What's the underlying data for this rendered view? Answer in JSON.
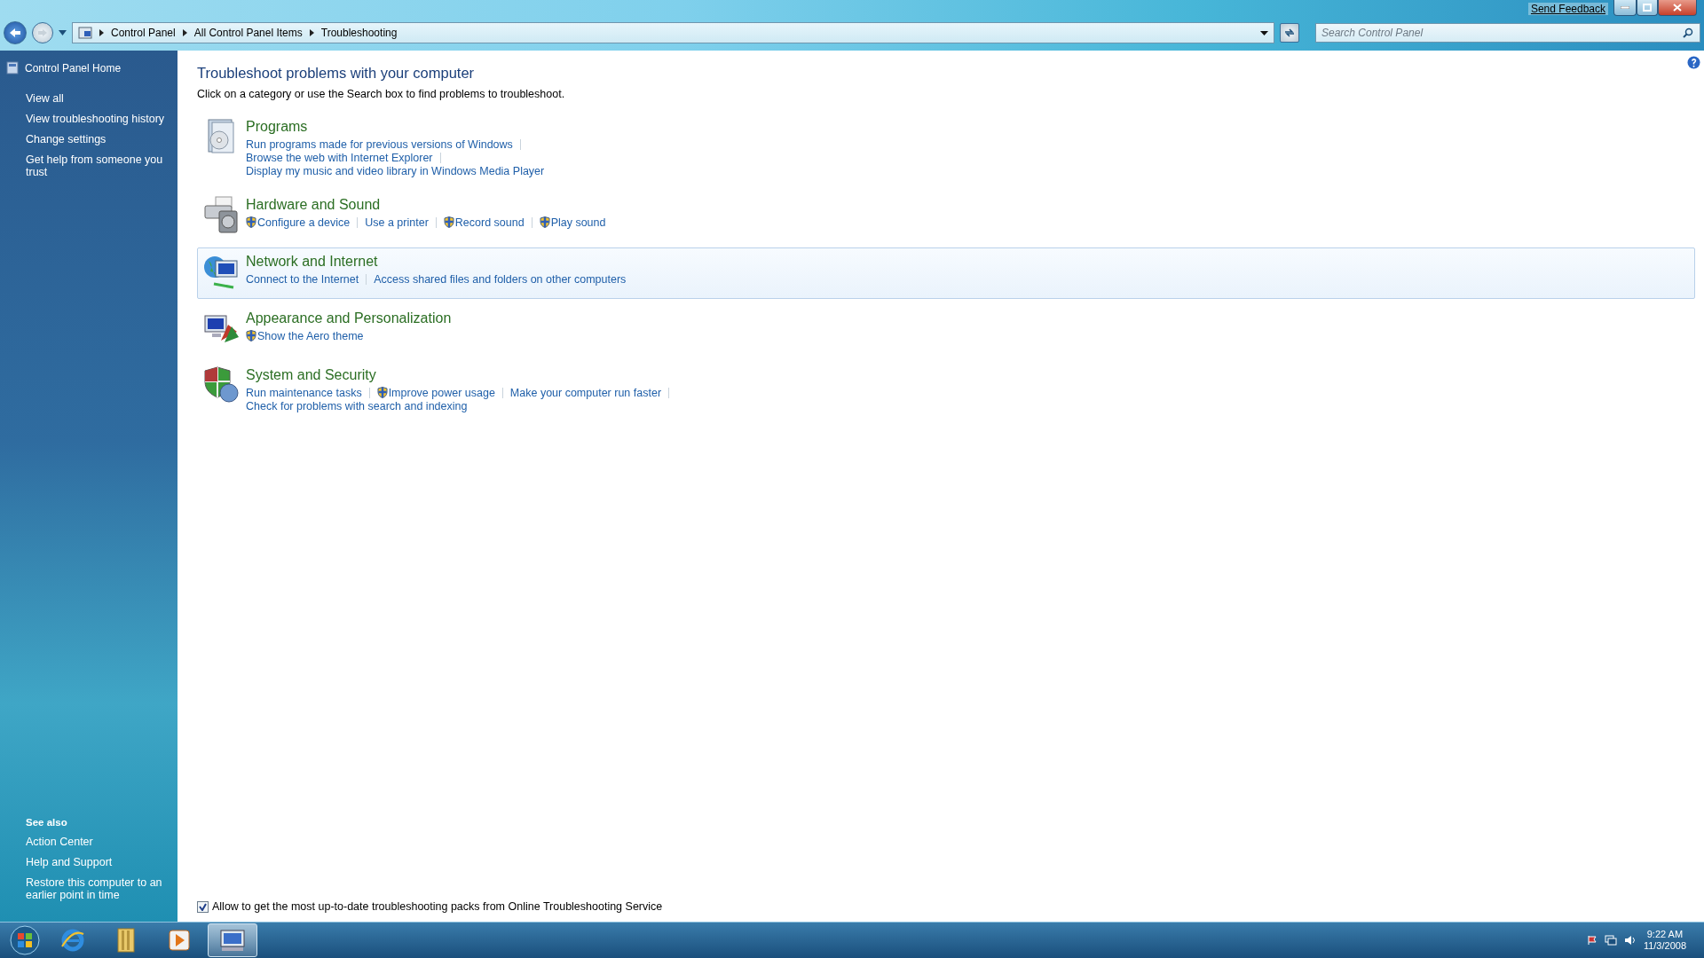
{
  "title_bar": {
    "feedback_link": "Send Feedback"
  },
  "address_bar": {
    "crumbs": [
      "Control Panel",
      "All Control Panel Items",
      "Troubleshooting"
    ]
  },
  "search": {
    "placeholder": "Search Control Panel"
  },
  "sidebar": {
    "home": "Control Panel Home",
    "items": [
      "View all",
      "View troubleshooting history",
      "Change settings",
      "Get help from someone you trust"
    ],
    "see_also_heading": "See also",
    "see_also": [
      "Action Center",
      "Help and Support",
      "Restore this computer to an earlier point in time"
    ]
  },
  "content": {
    "heading": "Troubleshoot problems with your computer",
    "intro": "Click on a category or use the Search box to find problems to troubleshoot.",
    "categories": [
      {
        "title": "Programs",
        "highlighted": false,
        "lines": [
          [
            {
              "label": "Run programs made for previous versions of Windows",
              "shield": false,
              "divider": true
            }
          ],
          [
            {
              "label": "Browse the web with Internet Explorer",
              "shield": false,
              "divider": true
            }
          ],
          [
            {
              "label": "Display my music and video library in Windows Media Player",
              "shield": false,
              "divider": false
            }
          ]
        ]
      },
      {
        "title": "Hardware and Sound",
        "highlighted": false,
        "lines": [
          [
            {
              "label": "Configure a device",
              "shield": true,
              "divider": true
            },
            {
              "label": "Use a printer",
              "shield": false,
              "divider": true
            },
            {
              "label": "Record sound",
              "shield": true,
              "divider": true
            },
            {
              "label": "Play sound",
              "shield": true,
              "divider": false
            }
          ]
        ]
      },
      {
        "title": "Network and Internet",
        "highlighted": true,
        "lines": [
          [
            {
              "label": "Connect to the Internet",
              "shield": false,
              "divider": true
            },
            {
              "label": "Access shared files and folders on other computers",
              "shield": false,
              "divider": false
            }
          ]
        ]
      },
      {
        "title": "Appearance and Personalization",
        "highlighted": false,
        "lines": [
          [
            {
              "label": "Show the Aero theme",
              "shield": true,
              "divider": false
            }
          ]
        ]
      },
      {
        "title": "System and Security",
        "highlighted": false,
        "lines": [
          [
            {
              "label": "Run maintenance tasks",
              "shield": false,
              "divider": true
            },
            {
              "label": "Improve power usage",
              "shield": true,
              "divider": true
            },
            {
              "label": "Make your computer run faster",
              "shield": false,
              "divider": true
            }
          ],
          [
            {
              "label": "Check for problems with search and indexing",
              "shield": false,
              "divider": false
            }
          ]
        ]
      }
    ],
    "online_option": {
      "label": "Allow to get the most up-to-date troubleshooting packs from Online Troubleshooting Service",
      "checked": true
    }
  },
  "taskbar": {
    "buttons": [
      {
        "selected": false
      },
      {
        "selected": false
      },
      {
        "selected": false
      },
      {
        "selected": true
      }
    ],
    "clock_time": "9:22 AM",
    "clock_date": "11/3/2008"
  }
}
